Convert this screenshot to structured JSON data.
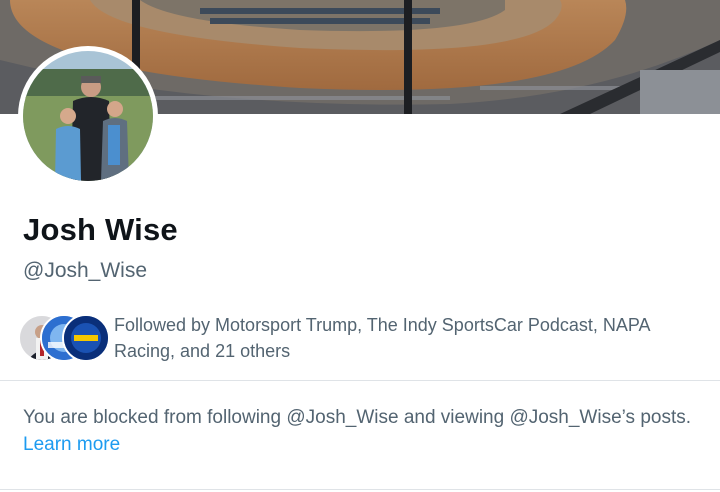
{
  "profile": {
    "name": "Josh Wise",
    "handle": "@Josh_Wise"
  },
  "followed_by": {
    "text": "Followed by Motorsport Trump, The Indy SportsCar Podcast, NAPA Racing, and 21 others"
  },
  "blocked_notice": {
    "message": "You are blocked from following @Josh_Wise and viewing @Josh_Wise’s posts.",
    "link_label": "Learn more"
  },
  "colors": {
    "primary_text": "#0f1419",
    "secondary_text": "#536471",
    "link": "#1d9bf0"
  }
}
